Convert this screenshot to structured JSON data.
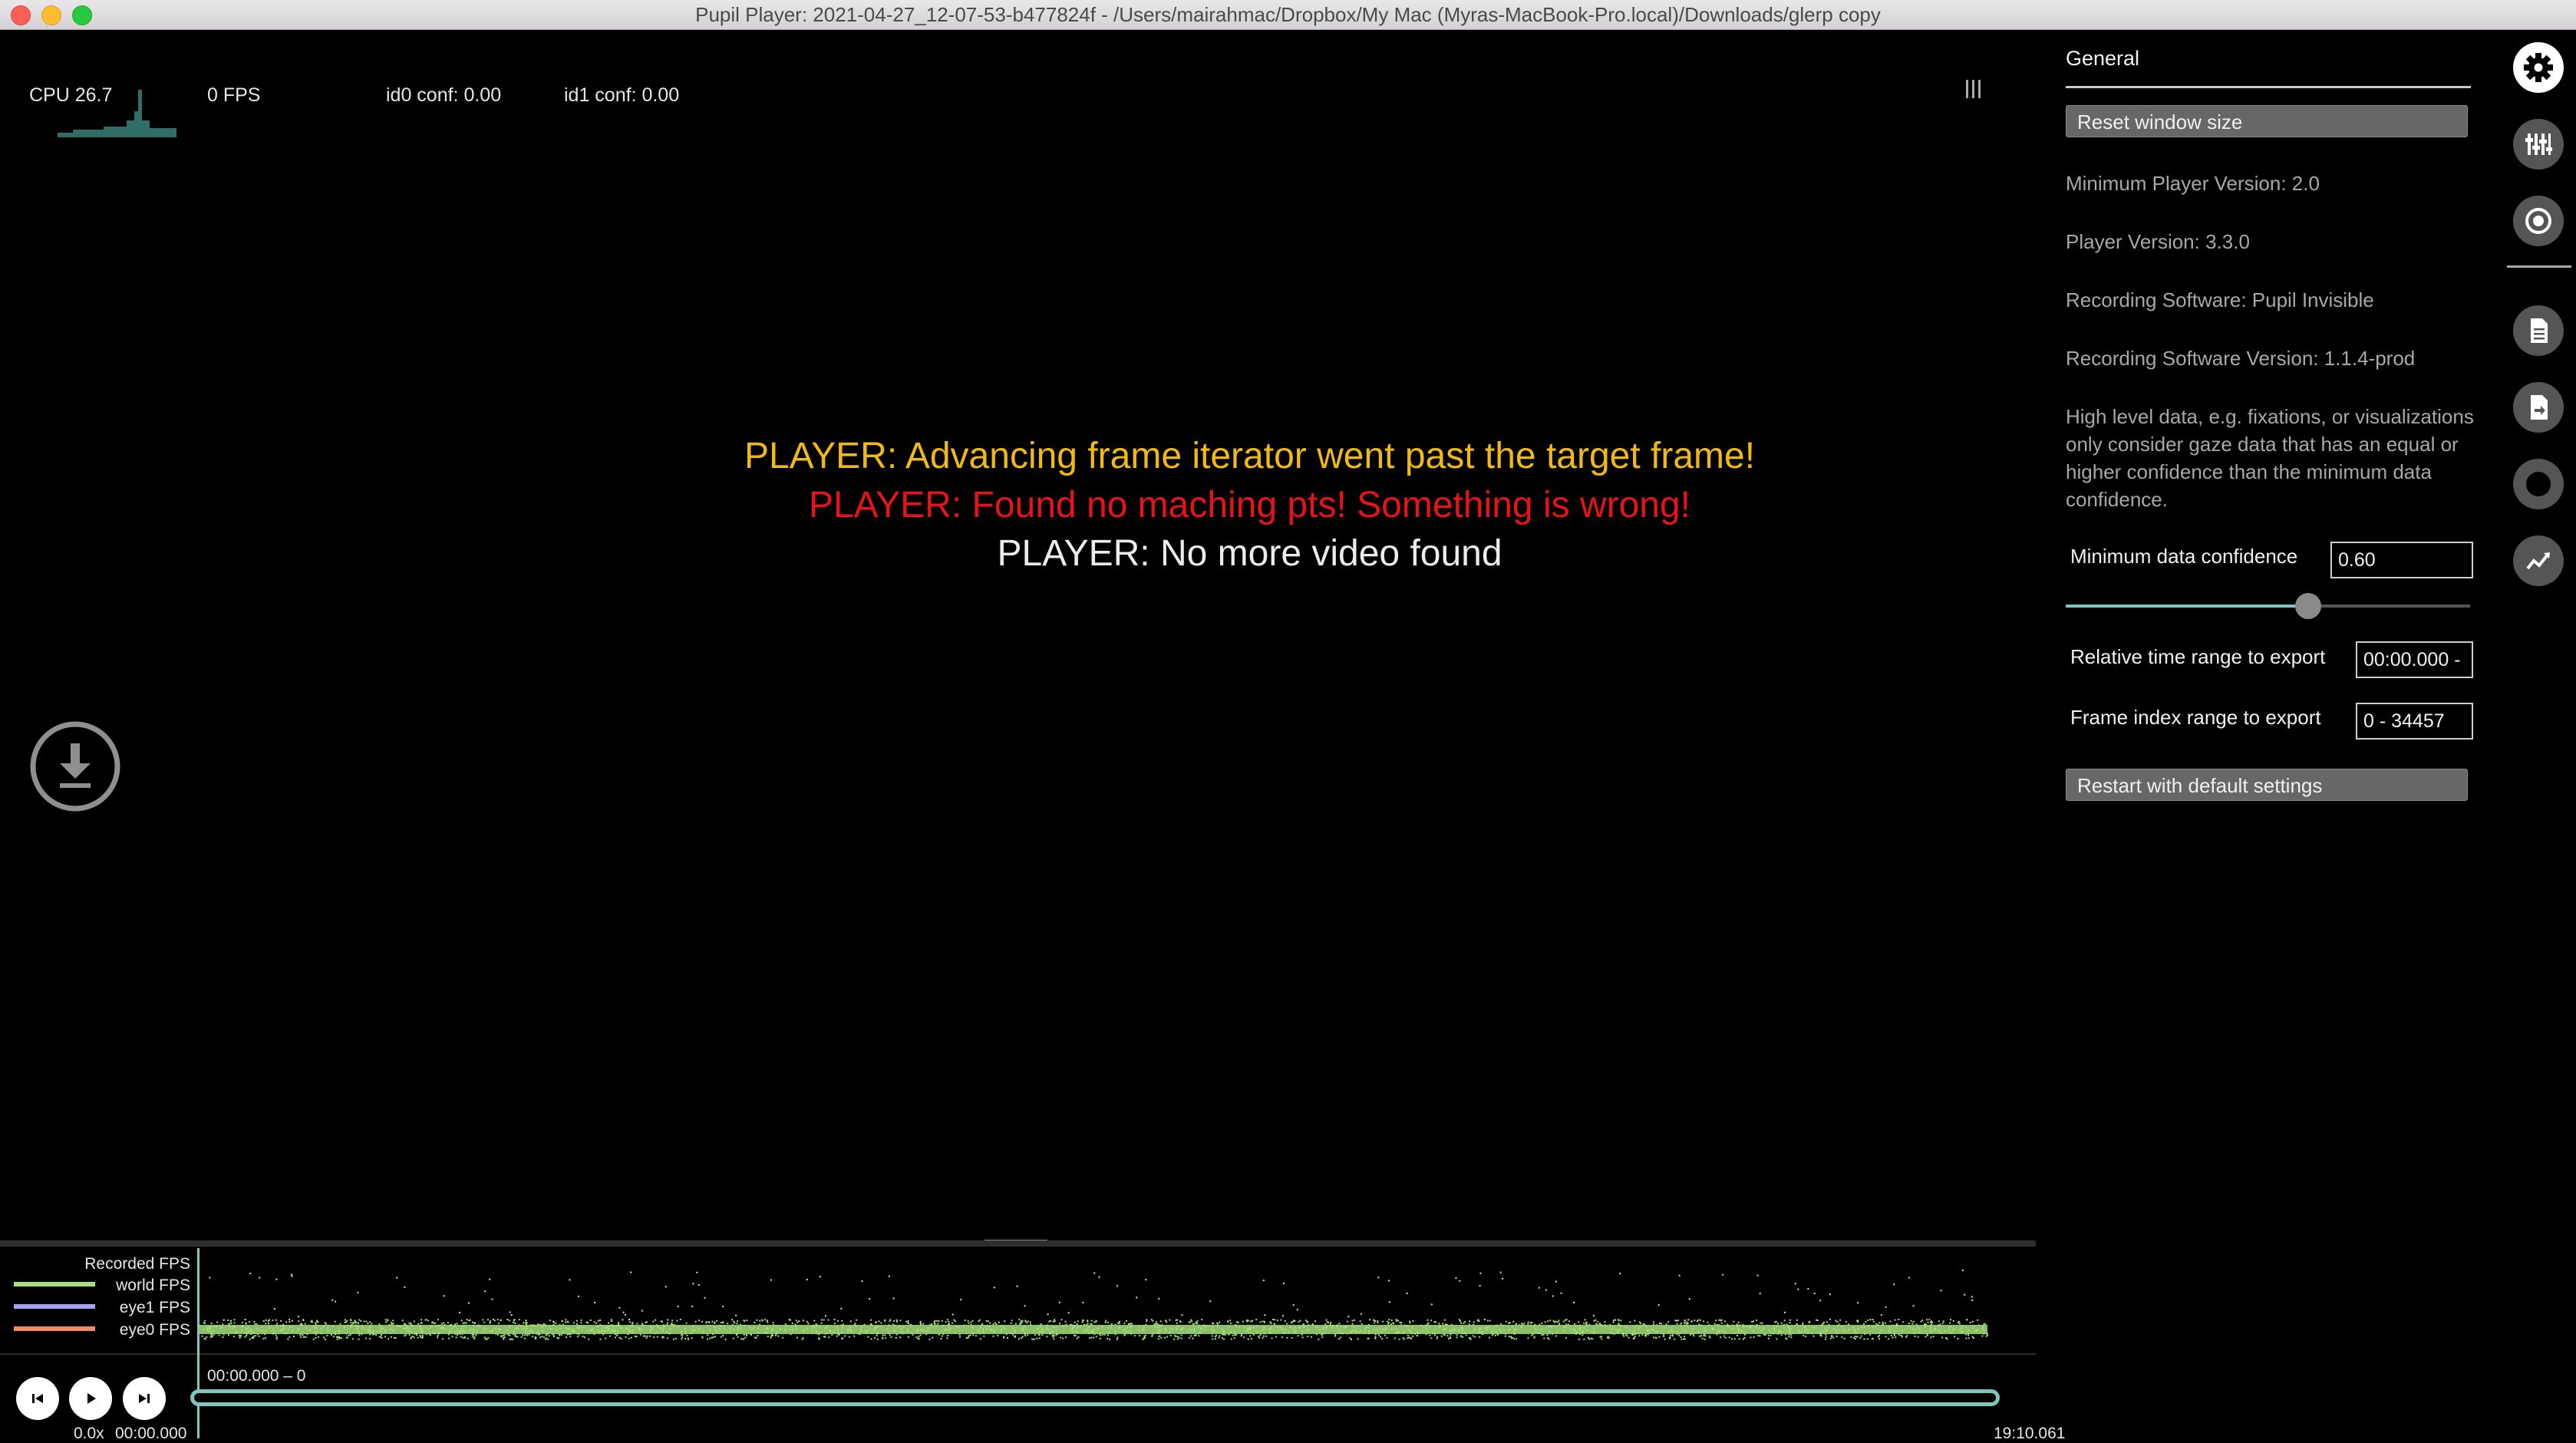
{
  "window": {
    "title": "Pupil Player: 2021-04-27_12-07-53-b477824f - /Users/mairahmac/Dropbox/My Mac (Myras-MacBook-Pro.local)/Downloads/glerp copy"
  },
  "hud": {
    "cpu": "CPU 26.7",
    "fps": "0 FPS",
    "id0_conf": "id0 conf: 0.00",
    "id1_conf": "id1 conf: 0.00"
  },
  "messages": {
    "warning": "PLAYER: Advancing frame iterator went past the target frame!",
    "error": "PLAYER: Found no maching pts! Something is wrong!",
    "info": "PLAYER: No more video found"
  },
  "panel": {
    "title": "General",
    "reset_button": "Reset window size",
    "min_player_version": "Minimum Player Version: 2.0",
    "player_version": "Player Version: 3.3.0",
    "recording_software": "Recording Software: Pupil Invisible",
    "recording_software_version": "Recording Software Version: 1.1.4-prod",
    "description": "High level data, e.g. fixations, or visualizations only consider gaze data that has an equal or higher confidence than the minimum data confidence.",
    "min_confidence_label": "Minimum data confidence",
    "min_confidence_value": "0.60",
    "min_confidence_slider": 0.6,
    "time_range_label": "Relative time range to export",
    "time_range_value": "00:00.000 -",
    "frame_range_label": "Frame index range to export",
    "frame_range_value": "0 - 34457",
    "restart_button": "Restart with default settings"
  },
  "sidebar_icons": [
    "gear-icon",
    "sliders-icon",
    "pupil-icon",
    "document-icon",
    "export-document-icon",
    "record-icon",
    "analytics-icon"
  ],
  "timeline": {
    "legend_title": "Recorded FPS",
    "legend": [
      {
        "label": "world FPS",
        "color": "#a6e07a"
      },
      {
        "label": "eye1 FPS",
        "color": "#a8a0f0"
      },
      {
        "label": "eye0 FPS",
        "color": "#f08c64"
      }
    ],
    "trim_range": "00:00.000 – 0",
    "speed": "0.0x",
    "current_time": "00:00.000",
    "end_time": "19:10.061"
  },
  "colors": {
    "accent": "#7fc6bf",
    "warning": "#f0b914",
    "error": "#e8121a"
  }
}
